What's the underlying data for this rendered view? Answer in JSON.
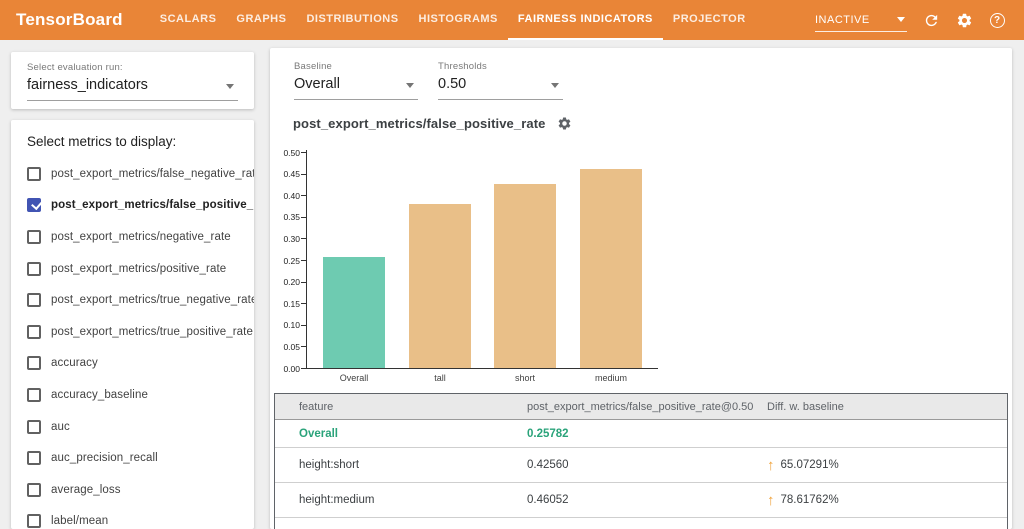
{
  "colors": {
    "header_orange": "#e98537",
    "bar_teal": "#6ecbb1",
    "bar_tan": "#e9bf88",
    "checkbox_blue": "#4154b3",
    "baseline_green": "#2aa37a",
    "diff_arrow_orange": "#f0a33c"
  },
  "navbar": {
    "brand": "TensorBoard",
    "tabs": [
      {
        "label": "SCALARS",
        "active": false
      },
      {
        "label": "GRAPHS",
        "active": false
      },
      {
        "label": "DISTRIBUTIONS",
        "active": false
      },
      {
        "label": "HISTOGRAMS",
        "active": false
      },
      {
        "label": "FAIRNESS INDICATORS",
        "active": true
      },
      {
        "label": "PROJECTOR",
        "active": false
      }
    ],
    "status_dropdown": {
      "value": "INACTIVE"
    },
    "help_glyph": "?"
  },
  "sidebar": {
    "run_select": {
      "label": "Select evaluation run:",
      "value": "fairness_indicators"
    },
    "metrics_title": "Select metrics to display:",
    "metrics": [
      {
        "label": "post_export_metrics/false_negative_rate",
        "checked": false
      },
      {
        "label": "post_export_metrics/false_positive_rate",
        "checked": true
      },
      {
        "label": "post_export_metrics/negative_rate",
        "checked": false
      },
      {
        "label": "post_export_metrics/positive_rate",
        "checked": false
      },
      {
        "label": "post_export_metrics/true_negative_rate",
        "checked": false
      },
      {
        "label": "post_export_metrics/true_positive_rate",
        "checked": false
      },
      {
        "label": "accuracy",
        "checked": false
      },
      {
        "label": "accuracy_baseline",
        "checked": false
      },
      {
        "label": "auc",
        "checked": false
      },
      {
        "label": "auc_precision_recall",
        "checked": false
      },
      {
        "label": "average_loss",
        "checked": false
      },
      {
        "label": "label/mean",
        "checked": false
      }
    ]
  },
  "controls": {
    "baseline": {
      "label": "Baseline",
      "value": "Overall"
    },
    "thresholds": {
      "label": "Thresholds",
      "value": "0.50"
    }
  },
  "chart_data": {
    "type": "bar",
    "title": "post_export_metrics/false_positive_rate",
    "categories": [
      "Overall",
      "tall",
      "short",
      "medium"
    ],
    "values": [
      0.25782,
      0.38,
      0.4256,
      0.46052
    ],
    "bar_colors": [
      "#6ecbb1",
      "#e9bf88",
      "#e9bf88",
      "#e9bf88"
    ],
    "ylim": [
      0,
      0.5
    ],
    "ytick_step": 0.05,
    "xlabel": "",
    "ylabel": "",
    "grid": false,
    "legend": "none"
  },
  "table": {
    "headers": [
      "feature",
      "post_export_metrics/false_positive_rate@0.50",
      "Diff. w. baseline"
    ],
    "rows": [
      {
        "feature": "Overall",
        "value": "0.25782",
        "diff": "",
        "baseline": true
      },
      {
        "feature": "height:short",
        "value": "0.42560",
        "diff": "65.07291%",
        "diff_direction": "up",
        "baseline": false
      },
      {
        "feature": "height:medium",
        "value": "0.46052",
        "diff": "78.61762%",
        "diff_direction": "up",
        "baseline": false
      }
    ],
    "up_arrow_glyph": "↑"
  }
}
